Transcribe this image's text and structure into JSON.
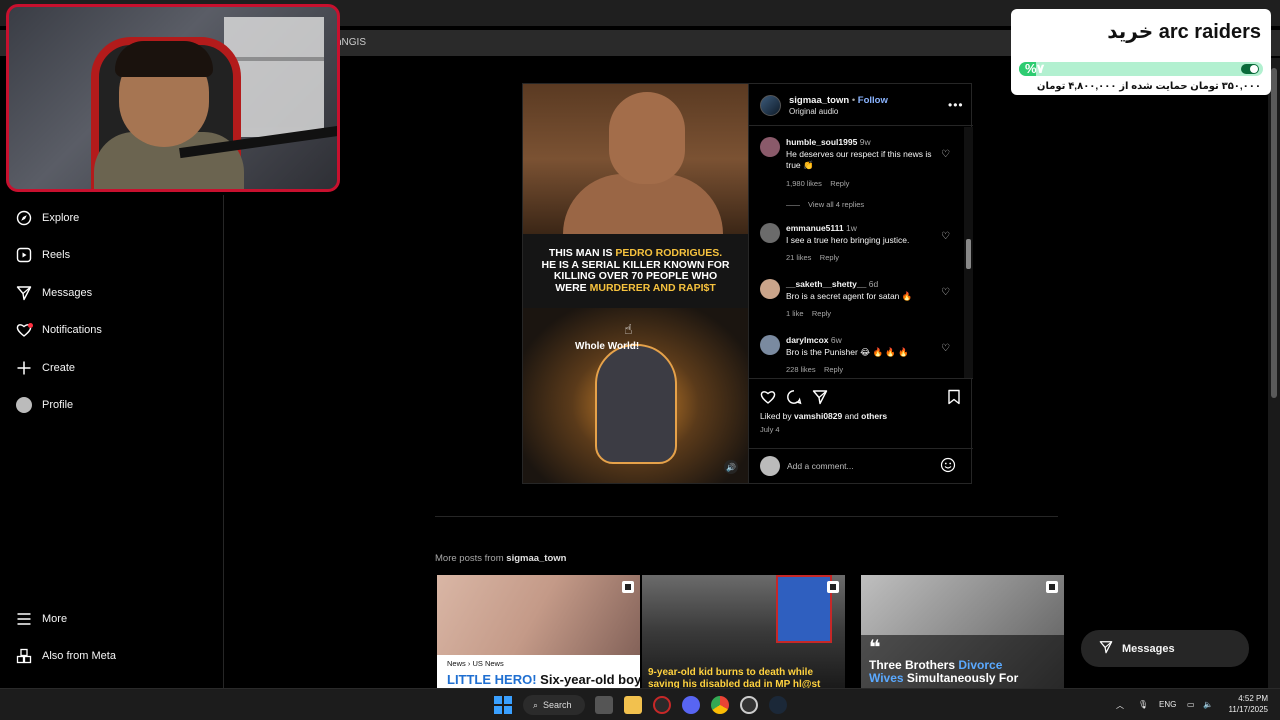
{
  "browser": {
    "crumb": "nNGIS"
  },
  "donation": {
    "title": "خرید arc raiders",
    "percent_label": "%۷",
    "progress_fraction": 0.07,
    "subtitle": "۳۵۰,۰۰۰ تومان حمایت شده از ۴,۸۰۰,۰۰۰ تومان"
  },
  "nav": {
    "items": [
      {
        "label": "Explore",
        "icon": "compass-icon"
      },
      {
        "label": "Reels",
        "icon": "reels-icon"
      },
      {
        "label": "Messages",
        "icon": "paper-plane-icon"
      },
      {
        "label": "Notifications",
        "icon": "heart-icon"
      },
      {
        "label": "Create",
        "icon": "plus-icon"
      },
      {
        "label": "Profile",
        "icon": "avatar-icon"
      }
    ],
    "more": "More",
    "also_from_meta": "Also from Meta"
  },
  "post": {
    "username": "sigmaa_town",
    "separator": "•",
    "follow": "Follow",
    "audio": "Original audio",
    "media": {
      "caption_l1_a": "THIS MAN IS ",
      "caption_l1_hl": "PEDRO RODRIGUES.",
      "caption_l2": "HE IS A SERIAL KILLER KNOWN FOR",
      "caption_l3": "KILLING OVER 70 PEOPLE WHO",
      "caption_l4_a": "WERE ",
      "caption_l4_hl": "MURDERER AND RAPI$T",
      "overlay": "Whole World!"
    },
    "comments": [
      {
        "user": "humble_soul1995",
        "age": "9w",
        "text": "He deserves our respect if this news is true 👏",
        "likes": "1,980 likes",
        "reply": "Reply",
        "avatar_color": "#8a5a6a"
      },
      {
        "user": "emmanue5111",
        "age": "1w",
        "text": "I see a true hero bringing justice.",
        "likes": "21 likes",
        "reply": "Reply",
        "avatar_color": "#6b6b6b"
      },
      {
        "user": "__saketh__shetty__",
        "age": "6d",
        "text": "Bro is a secret agent for satan 🔥",
        "likes": "1 like",
        "reply": "Reply",
        "avatar_color": "#caa48a"
      },
      {
        "user": "darylmcox",
        "age": "6w",
        "text": "Bro is the Punisher 😂 🔥 🔥 🔥",
        "likes": "228 likes",
        "reply": "Reply",
        "avatar_color": "#7a8aa0"
      }
    ],
    "view_replies": "View all 4 replies",
    "liked_by_prefix": "Liked by ",
    "liked_by_user": "vamshi0829",
    "liked_by_and": " and ",
    "liked_by_others": "others",
    "date": "July 4",
    "add_comment_placeholder": "Add a comment..."
  },
  "more_posts": {
    "prefix": "More posts from ",
    "user": "sigmaa_town"
  },
  "thumbs": [
    {
      "tag_a": "News",
      "tag_sep": " › ",
      "tag_b": "US News",
      "head_blue": "LITTLE HERO!",
      "head_rest": " Six-year-old boy"
    },
    {
      "text": "9-year-old kid burns to death while saving his disabled dad in MP hl@st"
    },
    {
      "quote": "❝",
      "line1_a": "Three Brothers ",
      "line1_blue": "Divorce",
      "line2_blue": "Wives",
      "line2_rest": " Simultaneously For"
    }
  ],
  "messages_pill": "Messages",
  "taskbar": {
    "search": "Search",
    "lang": "ENG",
    "time": "4:52 PM",
    "date": "11/17/2025"
  }
}
